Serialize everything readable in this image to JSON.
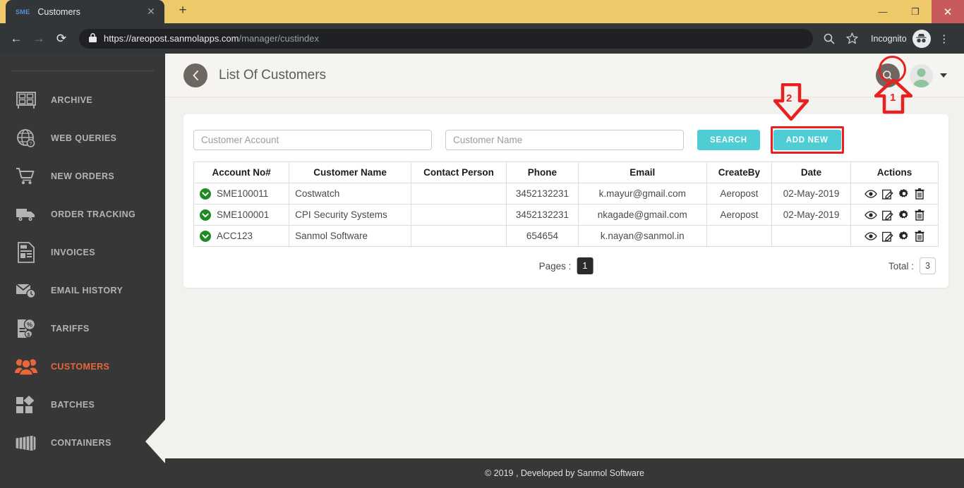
{
  "browser": {
    "tab": {
      "favicon_text": "SME",
      "title": "Customers",
      "close_icon": "✕"
    },
    "new_tab_icon": "+",
    "window_controls": {
      "minimize": "—",
      "maximize": "❐",
      "close": "✕"
    },
    "nav": {
      "back_icon": "←",
      "forward_icon": "→",
      "reload_icon": "⟳"
    },
    "address": {
      "lock_icon": "🔒",
      "url_origin": "https://areopost.sanmolapps.com",
      "url_path": "/manager/custindex"
    },
    "omnibox_search_icon": "search-icon",
    "bookmark_icon": "☆",
    "incognito_label": "Incognito",
    "menu_icon": "⋮"
  },
  "sidebar": {
    "items": [
      {
        "label": "ARCHIVE",
        "icon": "archive-icon",
        "active": false
      },
      {
        "label": "WEB QUERIES",
        "icon": "globe-question-icon",
        "active": false
      },
      {
        "label": "NEW ORDERS",
        "icon": "cart-icon",
        "active": false
      },
      {
        "label": "ORDER TRACKING",
        "icon": "truck-icon",
        "active": false
      },
      {
        "label": "INVOICES",
        "icon": "invoice-icon",
        "active": false
      },
      {
        "label": "EMAIL HISTORY",
        "icon": "envelope-clock-icon",
        "active": false
      },
      {
        "label": "TARIFFS",
        "icon": "tariff-percent-icon",
        "active": false
      },
      {
        "label": "CUSTOMERS",
        "icon": "users-icon",
        "active": true
      },
      {
        "label": "BATCHES",
        "icon": "batches-icon",
        "active": false
      },
      {
        "label": "CONTAINERS",
        "icon": "container-icon",
        "active": false
      }
    ],
    "active_color": "#e8663c"
  },
  "header": {
    "back_icon": "back-chevron-icon",
    "title": "List Of Customers",
    "search_icon": "search-icon",
    "avatar_icon": "user-avatar",
    "avatar_caret": "chevron-down-icon"
  },
  "filters": {
    "account_placeholder": "Customer Account",
    "account_value": "",
    "name_placeholder": "Customer Name",
    "name_value": "",
    "search_label": "SEARCH",
    "add_new_label": "ADD NEW",
    "button_color": "#4ecdd4"
  },
  "table": {
    "columns": [
      "Account No#",
      "Customer Name",
      "Contact Person",
      "Phone",
      "Email",
      "CreateBy",
      "Date",
      "Actions"
    ],
    "rows": [
      {
        "status_icon": "green-check-circle",
        "account": "SME100011",
        "name": "Costwatch",
        "contact": "",
        "phone": "3452132231",
        "email": "k.mayur@gmail.com",
        "createby": "Aeropost",
        "date": "02-May-2019",
        "actions": [
          "eye-icon",
          "edit-icon",
          "gear-icon",
          "trash-icon"
        ]
      },
      {
        "status_icon": "green-check-circle",
        "account": "SME100001",
        "name": "CPI Security Systems",
        "contact": "",
        "phone": "3452132231",
        "email": "nkagade@gmail.com",
        "createby": "Aeropost",
        "date": "02-May-2019",
        "actions": [
          "eye-icon",
          "edit-icon",
          "gear-icon",
          "trash-icon"
        ]
      },
      {
        "status_icon": "green-check-circle",
        "account": "ACC123",
        "name": "Sanmol Software",
        "contact": "",
        "phone": "654654",
        "email": "k.nayan@sanmol.in",
        "createby": "",
        "date": "",
        "actions": [
          "eye-icon",
          "edit-icon",
          "gear-icon",
          "trash-icon"
        ]
      }
    ]
  },
  "pagination": {
    "pages_label": "Pages :",
    "current_page": "1",
    "total_label": "Total :",
    "total_value": "3"
  },
  "footer": {
    "text": "© 2019 , Developed by Sanmol Software"
  },
  "annotations": {
    "color": "#e8201f",
    "marker_1": "1",
    "marker_2": "2"
  }
}
